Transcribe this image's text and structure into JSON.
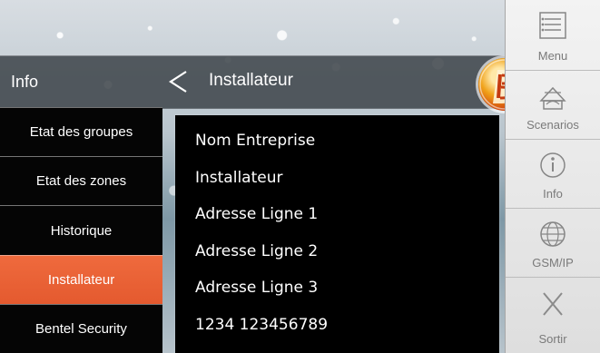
{
  "header": {
    "left_label": "Info",
    "title": "Installateur"
  },
  "left_menu": {
    "items": [
      {
        "label": "Etat des groupes"
      },
      {
        "label": "Etat des zones"
      },
      {
        "label": "Historique"
      },
      {
        "label": "Installateur",
        "active": true
      },
      {
        "label": "Bentel Security"
      }
    ]
  },
  "content": {
    "rows": [
      {
        "text": "Nom Entreprise"
      },
      {
        "text": "Installateur"
      },
      {
        "text": "Adresse Ligne 1"
      },
      {
        "text": "Adresse Ligne 2"
      },
      {
        "text": "Adresse Ligne 3"
      },
      {
        "text": "1234 123456789"
      }
    ]
  },
  "right_rail": {
    "buttons": [
      {
        "label": "Menu",
        "icon": "menu-icon"
      },
      {
        "label": "Scenarios",
        "icon": "scenarios-icon"
      },
      {
        "label": "Info",
        "icon": "info-icon"
      },
      {
        "label": "GSM/IP",
        "icon": "globe-icon"
      },
      {
        "label": "Sortir",
        "icon": "exit-icon"
      }
    ]
  },
  "colors": {
    "active_menu": "#e45a2f",
    "panel_background": "#000000",
    "rail_background": "#e9e9e9"
  }
}
